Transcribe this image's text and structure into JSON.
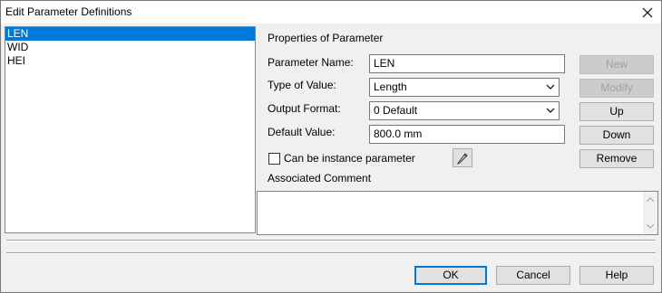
{
  "window": {
    "title": "Edit Parameter Definitions"
  },
  "parameters": [
    "LEN",
    "WID",
    "HEI"
  ],
  "selected_index": 0,
  "properties": {
    "section_title": "Properties of Parameter",
    "name_label": "Parameter Name:",
    "name_value": "LEN",
    "type_label": "Type of Value:",
    "type_value": "Length",
    "format_label": "Output Format:",
    "format_value": "0 Default",
    "default_label": "Default Value:",
    "default_value": "800.0 mm",
    "instance_checkbox_label": "Can be instance parameter",
    "instance_checked": false,
    "comment_label": "Associated Comment",
    "comment_value": ""
  },
  "side_buttons": {
    "new": "New",
    "modify": "Modify",
    "up": "Up",
    "down": "Down",
    "remove": "Remove"
  },
  "footer_buttons": {
    "ok": "OK",
    "cancel": "Cancel",
    "help": "Help"
  },
  "icons": {
    "close": "close-icon",
    "pencil": "pencil-icon",
    "chevron": "chevron-down-icon"
  },
  "colors": {
    "selection": "#0078d7",
    "default_button_border": "#0078d7"
  }
}
